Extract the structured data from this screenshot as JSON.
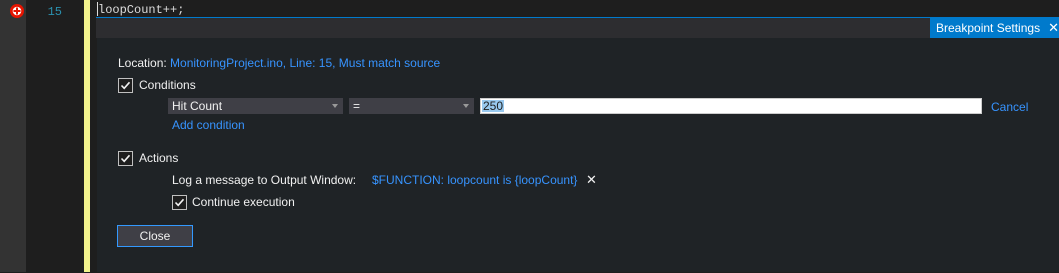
{
  "editor": {
    "line_number": "15",
    "code": "loopCount++;"
  },
  "peek": {
    "title": "Breakpoint Settings",
    "close_glyph": "✕"
  },
  "settings": {
    "location_label": "Location:",
    "location_value": "MonitoringProject.ino, Line: 15, Must match source",
    "conditions_label": "Conditions",
    "conditions_checked": true,
    "condition_type": "Hit Count",
    "condition_operator": "=",
    "condition_value": "250",
    "cancel_label": "Cancel",
    "add_condition_label": "Add condition",
    "actions_label": "Actions",
    "actions_checked": true,
    "log_message_label": "Log a message to Output Window:",
    "log_message_value": "$FUNCTION: loopcount is {loopCount}",
    "remove_glyph": "✕",
    "continue_label": "Continue execution",
    "continue_checked": true,
    "close_button": "Close"
  },
  "icons": {
    "breakpoint": "breakpoint-condition-icon",
    "checkbox": "checkmark-icon",
    "dropdown": "chevron-down-icon"
  },
  "colors": {
    "accent": "#007acc",
    "link": "#3794ff",
    "breakpoint_red": "#e51400",
    "current_line_bar": "#f2f28c"
  }
}
